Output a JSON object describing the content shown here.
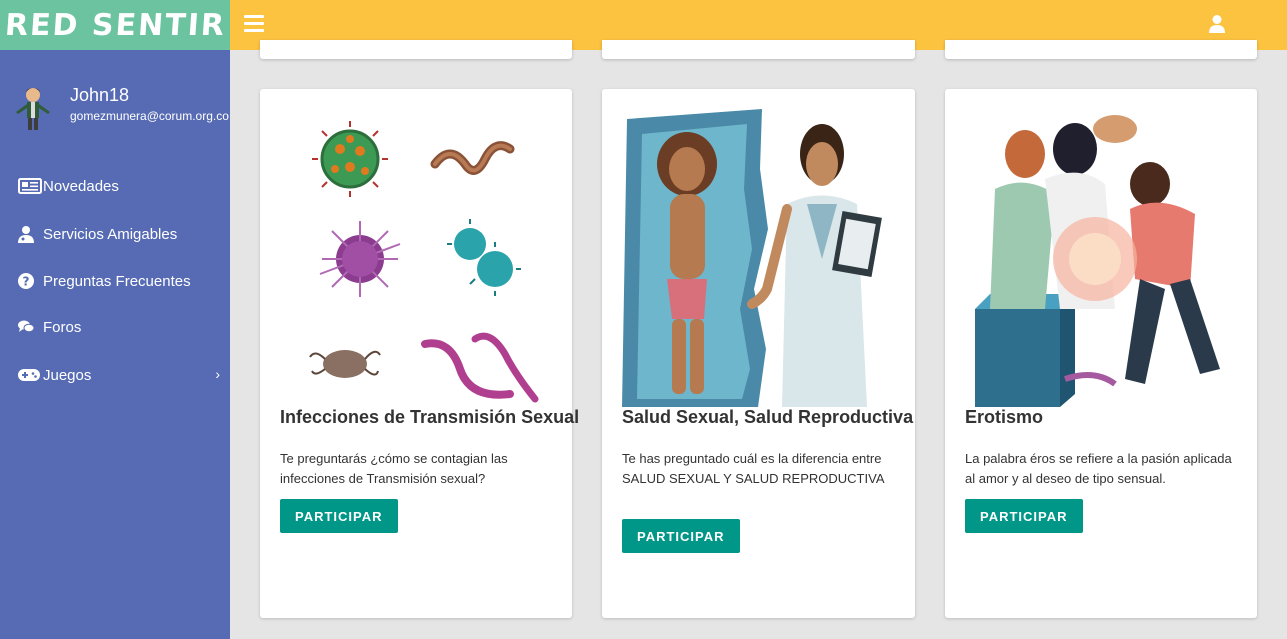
{
  "app": {
    "brand": "RED SENTIR"
  },
  "user": {
    "name": "John18",
    "email": "gomezmunera@corum.org.co"
  },
  "nav": [
    {
      "label": "Novedades",
      "icon": "newspaper-icon"
    },
    {
      "label": "Servicios Amigables",
      "icon": "user-md-icon"
    },
    {
      "label": "Preguntas Frecuentes",
      "icon": "question-circle-icon"
    },
    {
      "label": "Foros",
      "icon": "comments-icon"
    },
    {
      "label": "Juegos",
      "icon": "gamepad-icon"
    }
  ],
  "cards": [
    {
      "title": "Infecciones de Transmisión Sexual",
      "text": "Te preguntarás ¿cómo se contagian las infecciones de Transmisión sexual?",
      "button": "PARTICIPAR"
    },
    {
      "title": "Salud Sexual, Salud Reproductiva",
      "text": "Te has preguntado cuál es la diferencia entre SALUD SEXUAL Y SALUD REPRODUCTIVA",
      "button": "PARTICIPAR"
    },
    {
      "title": "Erotismo",
      "text": "La palabra éros se refiere a la pasión aplicada al amor y al deseo de tipo sensual.",
      "button": "PARTICIPAR"
    }
  ],
  "colors": {
    "brand_bg": "#6cc3a0",
    "sidebar_bg": "#566bb3",
    "topbar_bg": "#fcc341",
    "button_bg": "#009688",
    "page_bg": "#e5e5e5"
  }
}
